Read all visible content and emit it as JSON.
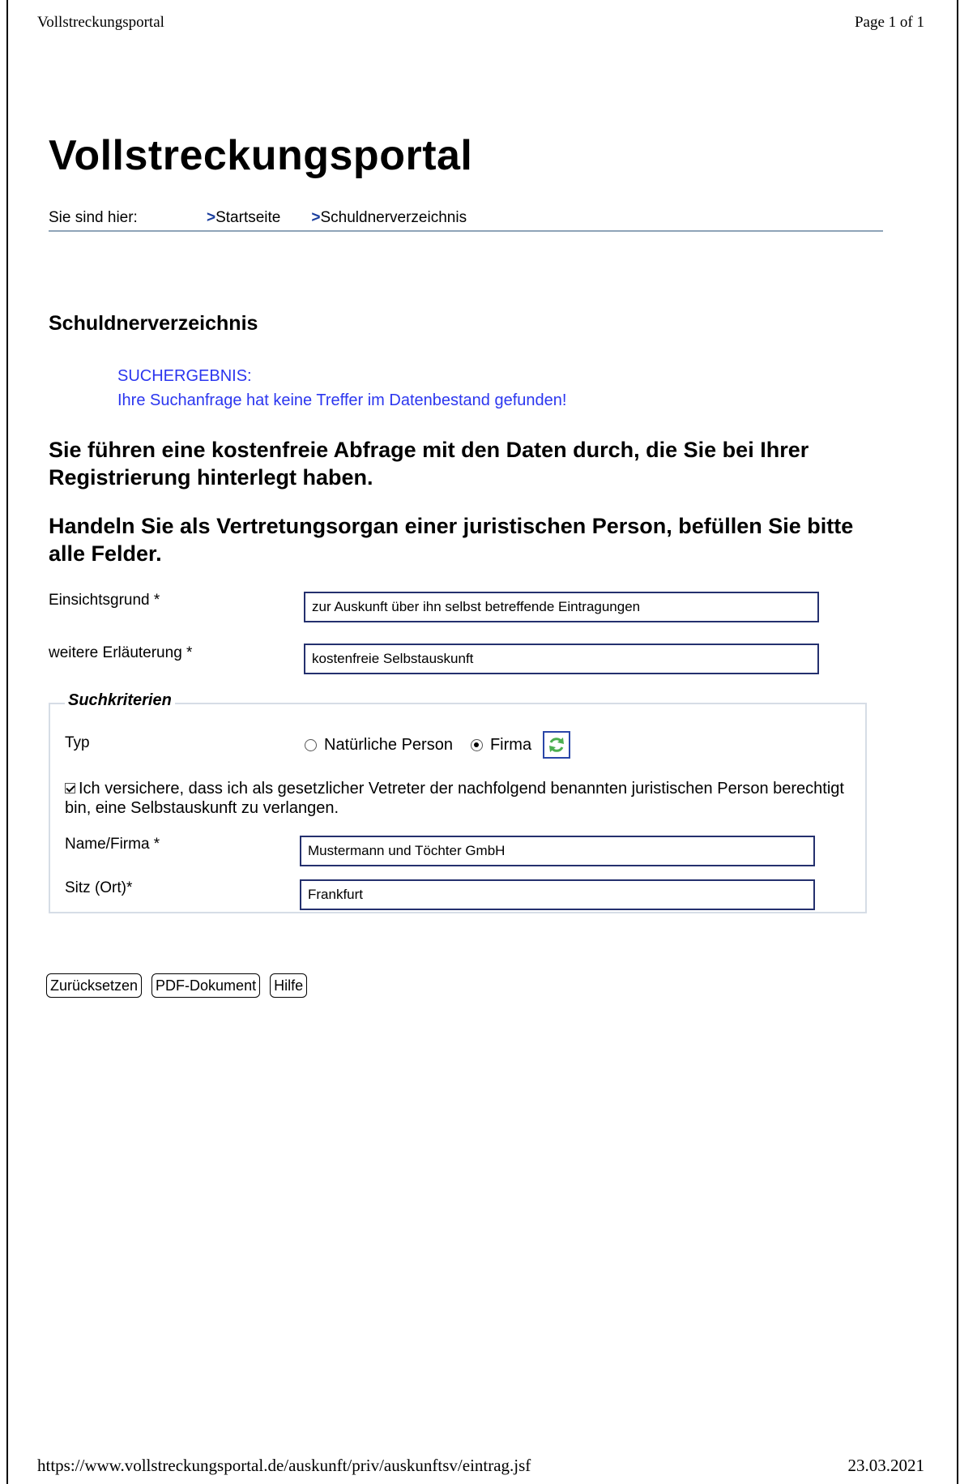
{
  "print_header": {
    "left": "Vollstreckungsportal",
    "right": "Page 1 of 1"
  },
  "print_footer": {
    "url": "https://www.vollstreckungsportal.de/auskunft/priv/auskunftsv/eintrag.jsf",
    "date": "23.03.2021"
  },
  "portal_title": "Vollstreckungsportal",
  "breadcrumb": {
    "prefix": "Sie sind hier:",
    "items": [
      {
        "marker": ">",
        "label": "Startseite"
      },
      {
        "marker": ">",
        "label": "Schuldnerverzeichnis"
      }
    ]
  },
  "section_title": "Schuldnerverzeichnis",
  "result": {
    "label": "SUCHERGEBNIS:",
    "message": "Ihre Suchanfrage hat keine Treffer im Datenbestand gefunden!"
  },
  "info_text_1": "Sie führen eine kostenfreie Abfrage mit den Daten durch, die Sie bei Ihrer Registrierung hinterlegt haben.",
  "info_text_2": "Handeln Sie als Vertretungsorgan einer juristischen Person, befüllen Sie bitte alle Felder.",
  "form": {
    "einsichtsgrund": {
      "label": "Einsichtsgrund *",
      "value": "zur Auskunft über ihn selbst betreffende Eintragungen"
    },
    "erlaeuterung": {
      "label": "weitere Erläuterung *",
      "value": "kostenfreie Selbstauskunft"
    }
  },
  "suchkriterien": {
    "legend": "Suchkriterien",
    "typ_label": "Typ",
    "options": [
      {
        "label": "Natürliche Person",
        "checked": false
      },
      {
        "label": "Firma",
        "checked": true
      }
    ],
    "refresh_icon": "refresh-icon",
    "confirmation": {
      "checked": true,
      "text": "Ich versichere, dass ich als gesetzlicher Vetreter der nachfolgend benannten juristischen Person berechtigt bin, eine Selbstauskunft zu verlangen."
    },
    "name": {
      "label": "Name/Firma *",
      "value": "Mustermann und Töchter GmbH"
    },
    "sitz": {
      "label": "Sitz (Ort)*",
      "value": "Frankfurt"
    }
  },
  "buttons": {
    "reset": "Zurücksetzen",
    "pdf": "PDF-Dokument",
    "help": "Hilfe"
  },
  "colors": {
    "result_text": "#2b36ef",
    "field_border": "#24306e",
    "breadcrumb_rule": "#8fa4b8",
    "refresh_arrows": "#4caf50"
  }
}
